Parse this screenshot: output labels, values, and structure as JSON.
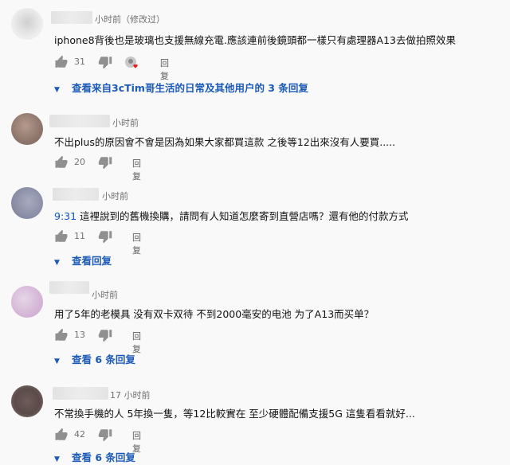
{
  "comments": [
    {
      "time": "小时前（修改过）",
      "text_prefix": "",
      "text": "iphone8背後也是玻璃也支援無線充電.應該連前後鏡頭都一樣只有處理器A13去做拍照效果",
      "likes": "31",
      "reply_label": "回复",
      "replies_label": "查看来自3cTim哥生活的日常及其他用户的 3 条回复",
      "avatar_color": "#e6e6e6"
    },
    {
      "time": "小时前",
      "text_prefix": "",
      "text": "不出plus的原因會不會是因為如果大家都買這款 之後等12出來沒有人要買.....",
      "likes": "20",
      "reply_label": "回复",
      "replies_label": "",
      "avatar_color": "#9c8276"
    },
    {
      "time": "小时前",
      "text_prefix": "9:31",
      "text": " 這裡說到的舊機換購，請問有人知道怎麼寄到直營店嗎？還有他的付款方式",
      "likes": "11",
      "reply_label": "回复",
      "replies_label": "查看回复",
      "avatar_color": "#8a8ea6"
    },
    {
      "time": "小时前",
      "text_prefix": "",
      "text": "用了5年的老模具 没有双卡双待 不到2000毫安的电池 为了A13而买单？",
      "likes": "13",
      "reply_label": "回复",
      "replies_label": "查看 6 条回复",
      "avatar_color": "#d6b8d8"
    },
    {
      "time": "17 小时前",
      "text_prefix": "",
      "text": "不常換手機的人 5年換一隻，等12比較實在 至少硬體配備支援5G 這隻看看就好...",
      "likes": "42",
      "reply_label": "回复",
      "replies_label": "查看 6 条回复",
      "avatar_color": "#5a4a48"
    }
  ],
  "icons": {
    "like": "thumbs-up-icon",
    "dislike": "thumbs-down-icon",
    "expand": "caret-down-icon",
    "heart": "creator-heart-icon"
  },
  "colors": {
    "link": "#1c5ab8",
    "timestamp_link": "#0b55c6",
    "meta": "#707070"
  }
}
